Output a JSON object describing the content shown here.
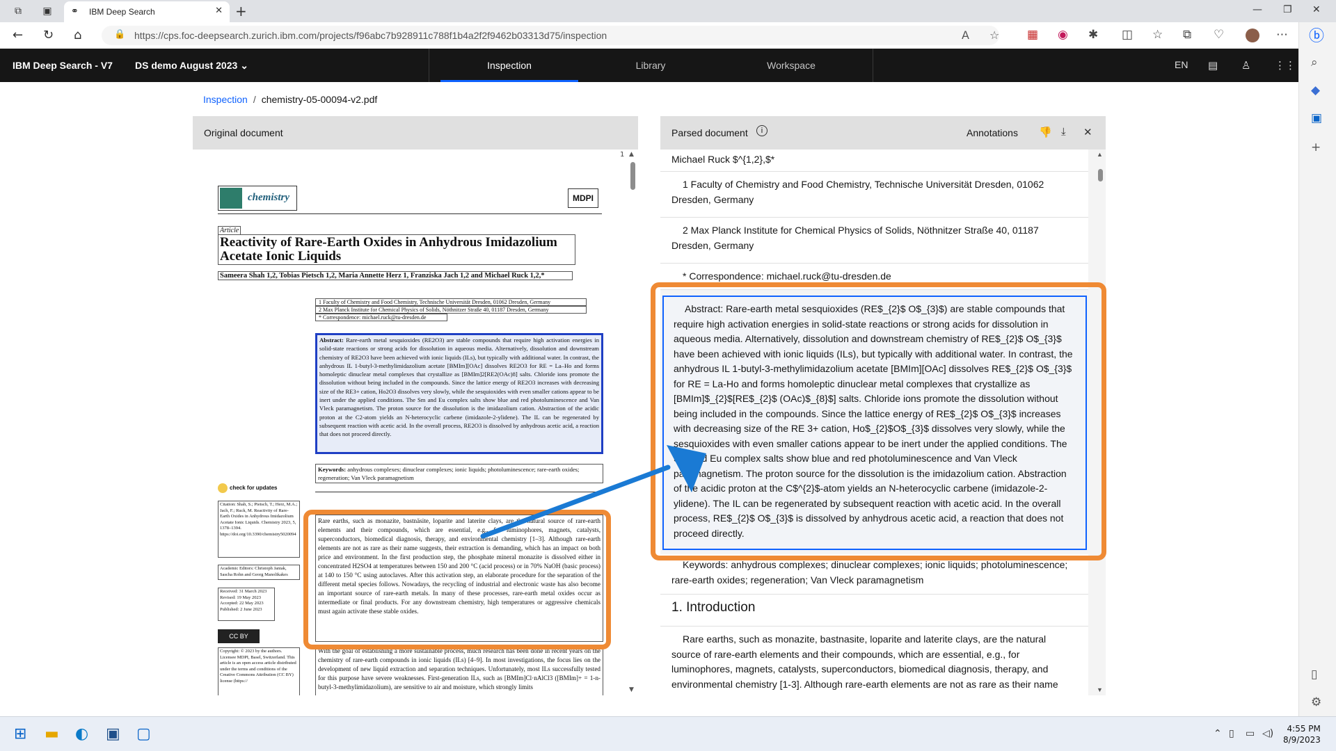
{
  "browser": {
    "tab_title": "IBM Deep Search",
    "url": "https://cps.foc-deepsearch.zurich.ibm.com/projects/f96abc7b928911c788f1b4a2f2f9462b03313d75/inspection"
  },
  "app": {
    "brand": "IBM Deep Search - V7",
    "project": "DS demo August 2023",
    "tabs": [
      "Inspection",
      "Library",
      "Workspace"
    ],
    "lang": "EN"
  },
  "breadcrumb": {
    "root": "Inspection",
    "sep": "/",
    "current": "chemistry-05-00094-v2.pdf"
  },
  "original": {
    "header": "Original document",
    "page_number": "1",
    "journal": "chemistry",
    "publisher": "MDPI",
    "article_label": "Article",
    "title": "Reactivity of Rare-Earth Oxides in Anhydrous Imidazolium Acetate Ionic Liquids",
    "authors": "Sameera Shah 1,2, Tobias Pietsch 1,2, Maria Annette Herz 1, Franziska Jach 1,2 and Michael Ruck 1,2,*",
    "affil1": "1  Faculty of Chemistry and Food Chemistry, Technische Universität Dresden, 01062 Dresden, Germany",
    "affil2": "2  Max Planck Institute for Chemical Physics of Solids, Nöthnitzer Straße 40, 01187 Dresden, Germany",
    "affil3": "*  Correspondence: michael.ruck@tu-dresden.de",
    "abstract_label": "Abstract:",
    "abstract": "Rare-earth metal sesquioxides (RE2O3) are stable compounds that require high activation energies in solid-state reactions or strong acids for dissolution in aqueous media. Alternatively, dissolution and downstream chemistry of RE2O3 have been achieved with ionic liquids (ILs), but typically with additional water. In contrast, the anhydrous IL 1-butyl-3-methylimidazolium acetate [BMIm][OAc] dissolves RE2O3 for RE = La–Ho and forms homoleptic dinuclear metal complexes that crystallize as [BMIm]2[RE2(OAc)8] salts. Chloride ions promote the dissolution without being included in the compounds. Since the lattice energy of RE2O3 increases with decreasing size of the RE3+ cation, Ho2O3 dissolves very slowly, while the sesquioxides with even smaller cations appear to be inert under the applied conditions. The Sm and Eu complex salts show blue and red photoluminescence and Van Vleck paramagnetism. The proton source for the dissolution is the imidazolium cation. Abstraction of the acidic proton at the C2-atom yields an N-heterocyclic carbene (imidazole-2-ylidene). The IL can be regenerated by subsequent reaction with acetic acid. In the overall process, RE2O3 is dissolved by anhydrous acetic acid, a reaction that does not proceed directly.",
    "keywords_label": "Keywords:",
    "keywords": "anhydrous complexes; dinuclear complexes; ionic liquids; photoluminescence; rare-earth oxides; regeneration; Van Vleck paramagnetism",
    "check_updates": "check for updates",
    "citation": "Citation: Shah, S.; Pietsch, T.; Herz, M.A.; Jach, F.; Ruck, M. Reactivity of Rare-Earth Oxides in Anhydrous Imidazolium Acetate Ionic Liquids. Chemistry 2023, 5, 1378–1394. https://doi.org/10.3390/chemistry5020094",
    "editors": "Academic Editors: Christoph Janiak, Sascha Rohn and Georg Manolikakes",
    "dates": "Received: 31 March 2023 Revised: 19 May 2023 Accepted: 22 May 2023 Published: 2 June 2023",
    "copyright": "Copyright: © 2023 by the authors. Licensee MDPI, Basel, Switzerland. This article is an open access article distributed under the terms and conditions of the Creative Commons Attribution (CC BY) license (https://",
    "cc_label": "CC BY",
    "intro_p1": "Rare earths, such as monazite, bastnäsite, loparite and laterite clays, are the natural source of rare-earth elements and their compounds, which are essential, e.g., for luminophores, magnets, catalysts, superconductors, biomedical diagnosis, therapy, and environmental chemistry [1–3]. Although rare-earth elements are not as rare as their name suggests, their extraction is demanding, which has an impact on both price and environment. In the first production step, the phosphate mineral monazite is dissolved either in concentrated H2SO4 at temperatures between 150 and 200 °C (acid process) or in 70% NaOH (basic process) at 140 to 150 °C using autoclaves. After this activation step, an elaborate procedure for the separation of the different metal species follows. Nowadays, the recycling of industrial and electronic waste has also become an important source of rare-earth metals. In many of these processes, rare-earth metal oxides occur as intermediate or final products. For any downstream chemistry, high temperatures or aggressive chemicals must again activate these stable oxides.",
    "intro_p2": "With the goal of establishing a more sustainable process, much research has been done in recent years on the chemistry of rare-earth compounds in ionic liquids (ILs) [4–9]. In most investigations, the focus lies on the development of new liquid extraction and separation techniques. Unfortunately, most ILs successfully tested for this purpose have severe weaknesses. First-generation ILs, such as [BMIm]Cl·nAlCl3 ([BMIm]+ = 1-n-butyl-3-methylimidazolium), are sensitive to air and moisture, which strongly limits"
  },
  "parsed": {
    "header": "Parsed document",
    "annotations_label": "Annotations",
    "blocks": {
      "authors_tail": "Michael Ruck $^{1,2},$*",
      "affil1": "1 Faculty of Chemistry and Food Chemistry, Technische Universität Dresden, 01062 Dresden, Germany",
      "affil2": "2 Max Planck Institute for Chemical Physics of Solids, Nöthnitzer Straße 40, 01187 Dresden, Germany",
      "corr": "* Correspondence: michael.ruck@tu-dresden.de",
      "abstract": "Abstract: Rare-earth metal sesquioxides (RE$_{2}$ O$_{3}$) are stable compounds that require high activation energies in solid-state reactions or strong acids for dissolution in aqueous media. Alternatively, dissolution and downstream chemistry of RE$_{2}$ O$_{3}$ have been achieved with ionic liquids (ILs), but typically with additional water. In contrast, the anhydrous IL 1-butyl-3-methylimidazolium acetate [BMIm][OAc] dissolves RE$_{2}$ O$_{3}$ for RE = La-Ho and forms homoleptic dinuclear metal complexes that crystallize as [BMIm]$_{2}$[RE$_{2}$ (OAc)$_{8}$] salts. Chloride ions promote the dissolution without being included in the compounds. Since the lattice energy of RE$_{2}$ O$_{3}$ increases with decreasing size of the RE 3+ cation, Ho$_{2}$O$_{3}$ dissolves very slowly, while the sesquioxides with even smaller cations appear to be inert under the applied conditions. The Sm and Eu complex salts show blue and red photoluminescence and Van Vleck paramagnetism. The proton source for the dissolution is the imidazolium cation. Abstraction of the acidic proton at the C$^{2}$-atom yields an N-heterocyclic carbene (imidazole-2-ylidene). The IL can be regenerated by subsequent reaction with acetic acid. In the overall process, RE$_{2}$ O$_{3}$ is dissolved by anhydrous acetic acid, a reaction that does not proceed directly.",
      "keywords": "Keywords: anhydrous complexes; dinuclear complexes; ionic liquids; photoluminescence; rare-earth oxides; regeneration; Van Vleck paramagnetism",
      "heading": "1. Introduction",
      "intro": "Rare earths, such as monazite, bastnasite, loparite and laterite clays, are the natural source of rare-earth elements and their compounds, which are essential, e.g., for luminophores, magnets, catalysts, superconductors, biomedical diagnosis, therapy, and environmental chemistry [1-3]. Although rare-earth elements are not as rare as their name suggests, their"
    }
  },
  "taskbar": {
    "time": "4:55 PM",
    "date": "8/9/2023"
  },
  "colors": {
    "accent": "#0f62fe",
    "highlight_orange": "#ef8a34",
    "arrow_blue": "#1a7ad4",
    "header_bg": "#161616"
  }
}
